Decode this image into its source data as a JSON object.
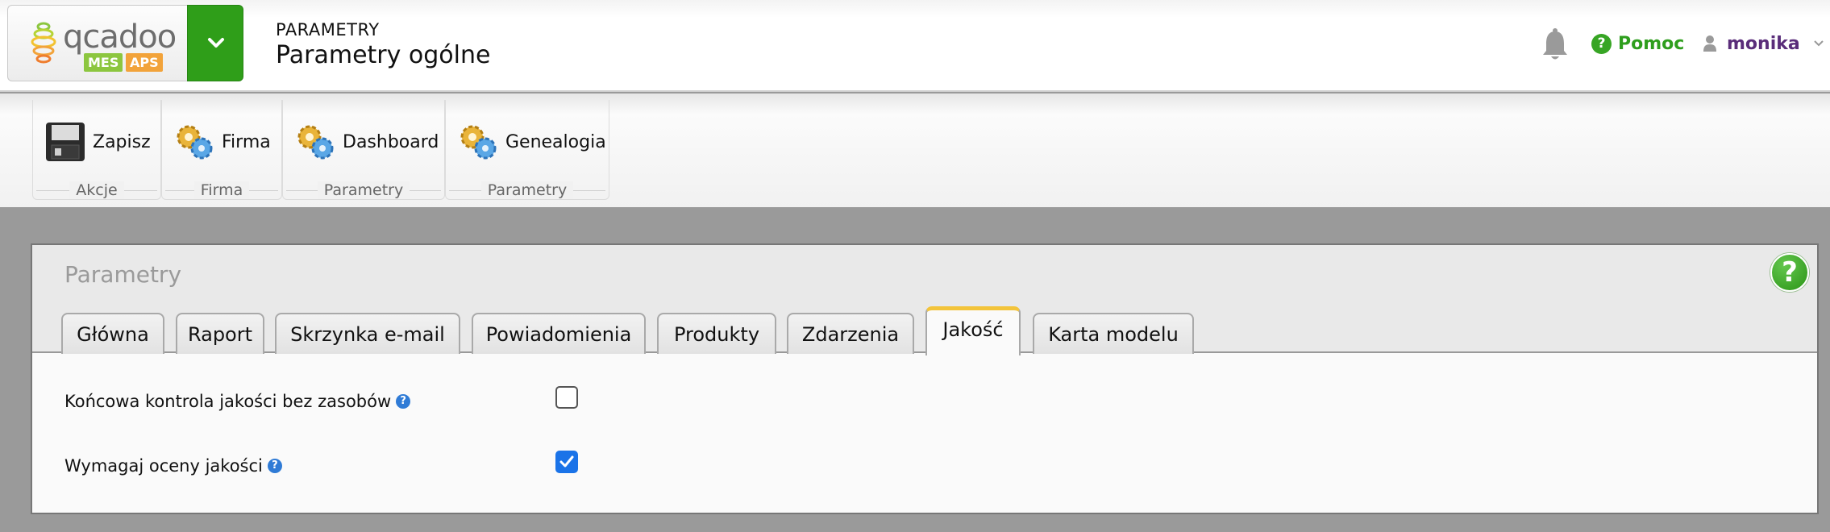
{
  "header": {
    "logo_text": "qcadoo",
    "badge_mes": "MES",
    "badge_aps": "APS",
    "breadcrumb_section": "PARAMETRY",
    "page_title": "Parametry ogólne",
    "help_label": "Pomoc",
    "user_name": "monika"
  },
  "ribbon": {
    "groups": [
      {
        "label": "Akcje",
        "button": "Zapisz",
        "icon": "floppy-disk-icon"
      },
      {
        "label": "Firma",
        "button": "Firma",
        "icon": "gears-icon"
      },
      {
        "label": "Parametry",
        "button": "Dashboard",
        "icon": "gears-icon"
      },
      {
        "label": "Parametry",
        "button": "Genealogia",
        "icon": "gears-icon"
      }
    ]
  },
  "panel": {
    "title": "Parametry",
    "tabs": [
      {
        "label": "Główna",
        "active": false
      },
      {
        "label": "Raport",
        "active": false
      },
      {
        "label": "Skrzynka e-mail",
        "active": false
      },
      {
        "label": "Powiadomienia",
        "active": false
      },
      {
        "label": "Produkty",
        "active": false
      },
      {
        "label": "Zdarzenia",
        "active": false
      },
      {
        "label": "Jakość",
        "active": true
      },
      {
        "label": "Karta modelu",
        "active": false
      }
    ],
    "fields": [
      {
        "label": "Końcowa kontrola jakości bez zasobów",
        "checked": false
      },
      {
        "label": "Wymagaj oceny jakości",
        "checked": true
      }
    ]
  },
  "colors": {
    "brand_green": "#2f9e19",
    "active_tab_accent": "#f3c43b",
    "checkbox_blue": "#1a73e8",
    "user_purple": "#5a2d7a"
  }
}
